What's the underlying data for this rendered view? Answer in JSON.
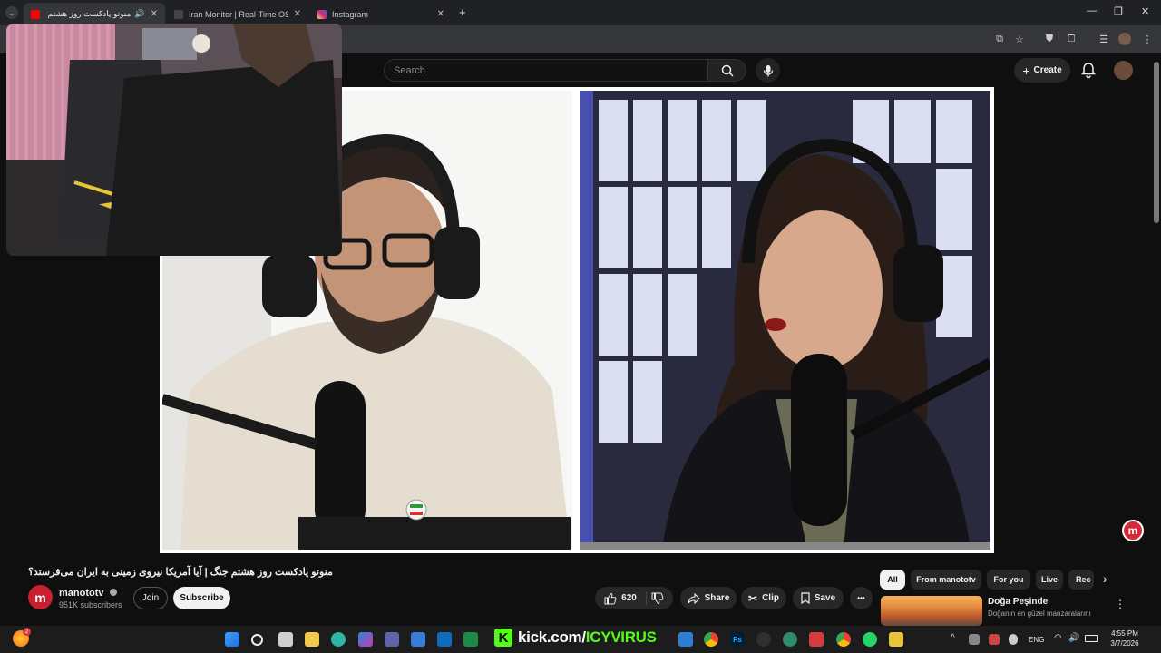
{
  "browser": {
    "tabs": [
      {
        "title": "منوتو پادکست روز هشتم جنگ",
        "favicon_color": "#ff0000",
        "active": true,
        "audio": true
      },
      {
        "title": "Iran Monitor | Real-Time OSINT",
        "favicon_color": "#444444",
        "active": false
      },
      {
        "title": "Instagram",
        "favicon_color": "#d6249f",
        "active": false
      }
    ],
    "new_tab": "+",
    "window_controls": {
      "minimize": "—",
      "restore": "❐",
      "close": "✕"
    }
  },
  "youtube": {
    "search": {
      "placeholder": "Search"
    },
    "create_label": "Create",
    "video": {
      "title": "منوتو پادکست روز هشتم جنگ | آیا آمریکا نیروی زمینی به ایران می‌فرستد؟",
      "channel_logo_letter": "m"
    },
    "channel": {
      "name": "manototv",
      "subscribers": "951K subscribers",
      "verified": true
    },
    "buttons": {
      "join": "Join",
      "subscribe": "Subscribe",
      "likes": "620",
      "share": "Share",
      "clip": "Clip",
      "save": "Save",
      "more": "•••"
    },
    "chips": [
      "All",
      "From manototv",
      "For you",
      "Live",
      "Rec"
    ],
    "recommendation": {
      "title": "Doğa Peşinde",
      "subtitle": "Doğanın en güzel manzaralarını"
    }
  },
  "overlay": {
    "kick_prefix": "kick.com/",
    "kick_handle": "ICYVIRUS",
    "kick_color": "#53fc18"
  },
  "taskbar": {
    "lang": "ENG",
    "time": "4:55 PM",
    "date": "3/7/2026",
    "notification_count": "2"
  },
  "colors": {
    "accent_red": "#ff0000",
    "manoto_red": "#d42a3a",
    "background": "#0f0f0f"
  }
}
